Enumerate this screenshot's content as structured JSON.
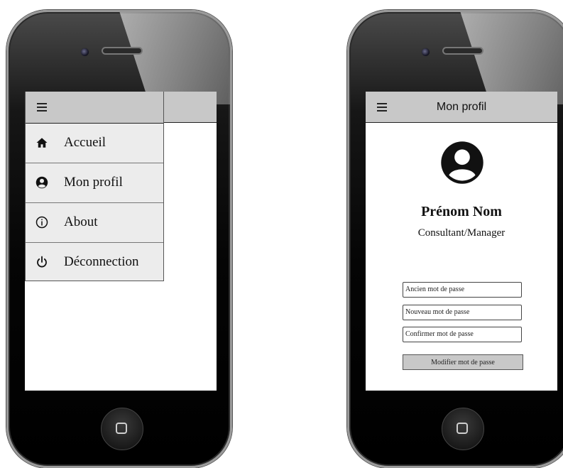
{
  "left_phone": {
    "menu": {
      "items": [
        {
          "label": "Accueil",
          "icon": "home-icon"
        },
        {
          "label": "Mon profil",
          "icon": "user-circle-icon"
        },
        {
          "label": "About",
          "icon": "info-icon"
        },
        {
          "label": "Déconnection",
          "icon": "power-icon"
        }
      ]
    }
  },
  "right_phone": {
    "header": {
      "title": "Mon profil"
    },
    "profile": {
      "name": "Prénom Nom",
      "role": "Consultant/Manager"
    },
    "form": {
      "old_password_placeholder": "Ancien mot de passe",
      "new_password_placeholder": "Nouveau mot de passe",
      "confirm_password_placeholder": "Confirmer mot de passe",
      "submit_label": "Modifier mot de passe"
    }
  }
}
